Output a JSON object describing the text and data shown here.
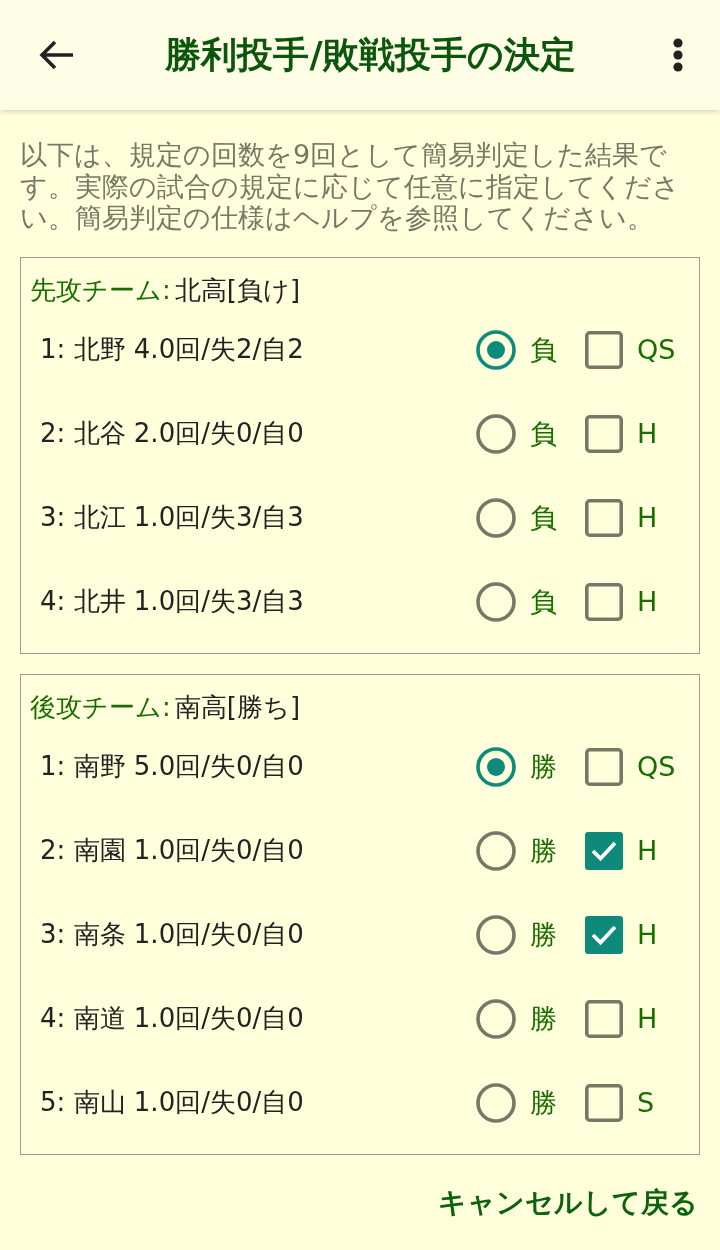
{
  "app_bar": {
    "title": "勝利投手/敗戦投手の決定"
  },
  "intro": "以下は、規定の回数を9回として簡易判定した結果です。実際の試合の規定に応じて任意に指定してください。簡易判定の仕様はヘルプを参照してください。",
  "teams": [
    {
      "heading": "先攻チーム:",
      "team": "北高[負け]",
      "pitchers": [
        {
          "line": "1: 北野 4.0回/失2/自2",
          "decision": "負",
          "selected": true,
          "tag": "QS",
          "checked": false
        },
        {
          "line": "2: 北谷 2.0回/失0/自0",
          "decision": "負",
          "selected": false,
          "tag": "H",
          "checked": false
        },
        {
          "line": "3: 北江 1.0回/失3/自3",
          "decision": "負",
          "selected": false,
          "tag": "H",
          "checked": false
        },
        {
          "line": "4: 北井 1.0回/失3/自3",
          "decision": "負",
          "selected": false,
          "tag": "H",
          "checked": false
        }
      ]
    },
    {
      "heading": "後攻チーム:",
      "team": "南高[勝ち]",
      "pitchers": [
        {
          "line": "1: 南野 5.0回/失0/自0",
          "decision": "勝",
          "selected": true,
          "tag": "QS",
          "checked": false
        },
        {
          "line": "2: 南園 1.0回/失0/自0",
          "decision": "勝",
          "selected": false,
          "tag": "H",
          "checked": true
        },
        {
          "line": "3: 南条 1.0回/失0/自0",
          "decision": "勝",
          "selected": false,
          "tag": "H",
          "checked": true
        },
        {
          "line": "4: 南道 1.0回/失0/自0",
          "decision": "勝",
          "selected": false,
          "tag": "H",
          "checked": false
        },
        {
          "line": "5: 南山 1.0回/失0/自0",
          "decision": "勝",
          "selected": false,
          "tag": "S",
          "checked": false
        }
      ]
    }
  ],
  "cancel_button": "キャンセルして戻る"
}
